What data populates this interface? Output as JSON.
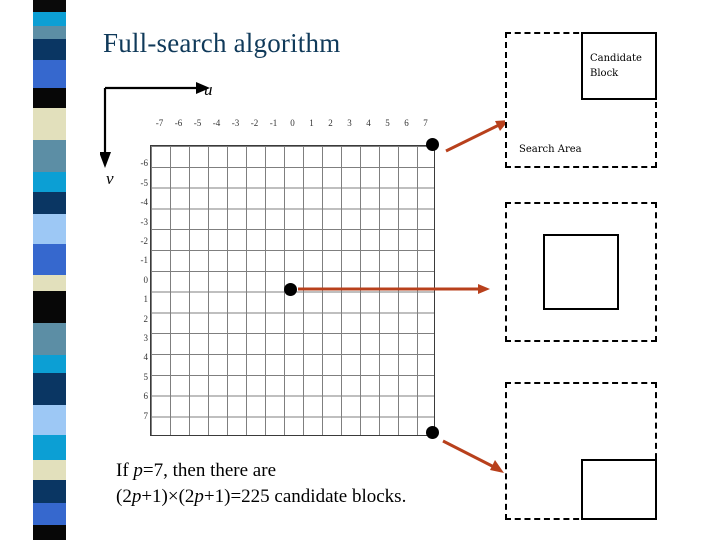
{
  "slide": {
    "title": "Full-search algorithm",
    "background": "#ffffff",
    "title_color": "#103A5A"
  },
  "axes": {
    "u_label": "u",
    "v_label": "v"
  },
  "caption": {
    "line1_a": "If ",
    "line1_p": "p",
    "line1_b": "=7, then there are",
    "line2_a": "(2",
    "line2_p1": "p",
    "line2_b": "+1)×(2",
    "line2_p2": "p",
    "line2_c": "+1)=225 candidate blocks."
  },
  "diagram": {
    "search_area_label": "Search Area",
    "candidate_block_label_line1": "Candidate",
    "candidate_block_label_line2": "Block",
    "arrow_color": "#B8401C"
  },
  "chart_data": {
    "type": "scatter",
    "title": "Full-search algorithm",
    "xlabel": "u",
    "ylabel": "v",
    "grid": true,
    "xlim": [
      -7,
      7
    ],
    "ylim": [
      -7,
      7
    ],
    "xticks": [
      "-7",
      "-6",
      "-5",
      "-4",
      "-3",
      "-2",
      "-1",
      "0",
      "1",
      "2",
      "3",
      "4",
      "5",
      "6",
      "7"
    ],
    "yticks": [
      "-6",
      "-5",
      "-4",
      "-3",
      "-2",
      "-1",
      "0",
      "1",
      "2",
      "3",
      "4",
      "5",
      "6",
      "7"
    ],
    "points": [
      {
        "x": 7,
        "y": -7,
        "label": "top-right candidate"
      },
      {
        "x": 0,
        "y": 0,
        "label": "center candidate"
      },
      {
        "x": 7,
        "y": 7,
        "label": "bottom-right candidate"
      }
    ]
  },
  "color_strip": {
    "bands": [
      {
        "top": 0,
        "height": 12,
        "color": "#0A0A0A"
      },
      {
        "top": 12,
        "height": 14,
        "color": "#0C9FD4"
      },
      {
        "top": 26,
        "height": 13,
        "color": "#5C8EA5"
      },
      {
        "top": 39,
        "height": 21,
        "color": "#0A3663"
      },
      {
        "top": 60,
        "height": 28,
        "color": "#3668CE"
      },
      {
        "top": 88,
        "height": 20,
        "color": "#070707"
      },
      {
        "top": 108,
        "height": 32,
        "color": "#E2E0BC"
      },
      {
        "top": 140,
        "height": 32,
        "color": "#5C8EA5"
      },
      {
        "top": 172,
        "height": 20,
        "color": "#0C9FD4"
      },
      {
        "top": 192,
        "height": 22,
        "color": "#0A3663"
      },
      {
        "top": 214,
        "height": 30,
        "color": "#9DC8F5"
      },
      {
        "top": 244,
        "height": 31,
        "color": "#3668CE"
      },
      {
        "top": 275,
        "height": 16,
        "color": "#E2E0BC"
      },
      {
        "top": 291,
        "height": 32,
        "color": "#070707"
      },
      {
        "top": 323,
        "height": 32,
        "color": "#5C8EA5"
      },
      {
        "top": 355,
        "height": 18,
        "color": "#0C9FD4"
      },
      {
        "top": 373,
        "height": 32,
        "color": "#0A3663"
      },
      {
        "top": 405,
        "height": 30,
        "color": "#9DC8F5"
      },
      {
        "top": 435,
        "height": 25,
        "color": "#0C9FD4"
      },
      {
        "top": 460,
        "height": 20,
        "color": "#E2E0BC"
      },
      {
        "top": 480,
        "height": 23,
        "color": "#0A3663"
      },
      {
        "top": 503,
        "height": 22,
        "color": "#3668CE"
      },
      {
        "top": 525,
        "height": 15,
        "color": "#070707"
      }
    ]
  }
}
